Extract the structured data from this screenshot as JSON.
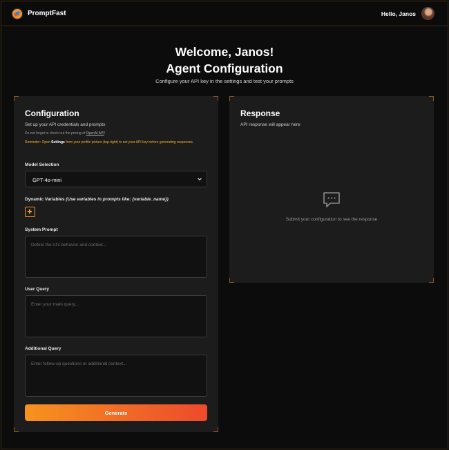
{
  "app": {
    "brand": "PromptFast"
  },
  "header": {
    "greeting": "Hello, Janos"
  },
  "hero": {
    "welcome": "Welcome, Janos!",
    "title": "Agent Configuration",
    "subtitle": "Configure your API key in the settings and test your prompts"
  },
  "config": {
    "title": "Configuration",
    "subtitle": "Set up your API credentials and prompts",
    "pricing_prefix": "Do not forget to check out the pricing of ",
    "pricing_link": "OpenAI API",
    "pricing_suffix": "!",
    "reminder_prefix": "Reminder: Open ",
    "reminder_bold": "Settings",
    "reminder_suffix": " from your profile picture (top-right) to set your API key before generating responses.",
    "model_label": "Model Selection",
    "model_value": "GPT-4o-mini",
    "variables_label": "Dynamic Variables",
    "variables_hint": "(Use variables in prompts like: {variable_name})",
    "system_label": "System Prompt",
    "system_placeholder": "Define the AI's behavior and context...",
    "user_label": "User Query",
    "user_placeholder": "Enter your main query...",
    "additional_label": "Additional Query",
    "additional_placeholder": "Enter follow-up questions or additional context...",
    "generate_label": "Generate"
  },
  "response": {
    "title": "Response",
    "hint": "API response will appear here",
    "empty_text": "Submit your configuration to see the response"
  },
  "colors": {
    "accent": "#f0962a",
    "reminder": "#f0b429",
    "card_bg": "#1c1c1c",
    "page_bg": "#0c0c0c"
  },
  "icons": {
    "logo": "promptfast-logo-icon",
    "add": "plus-square-icon",
    "chevron": "chevron-down-icon",
    "empty": "message-bubble-icon"
  }
}
